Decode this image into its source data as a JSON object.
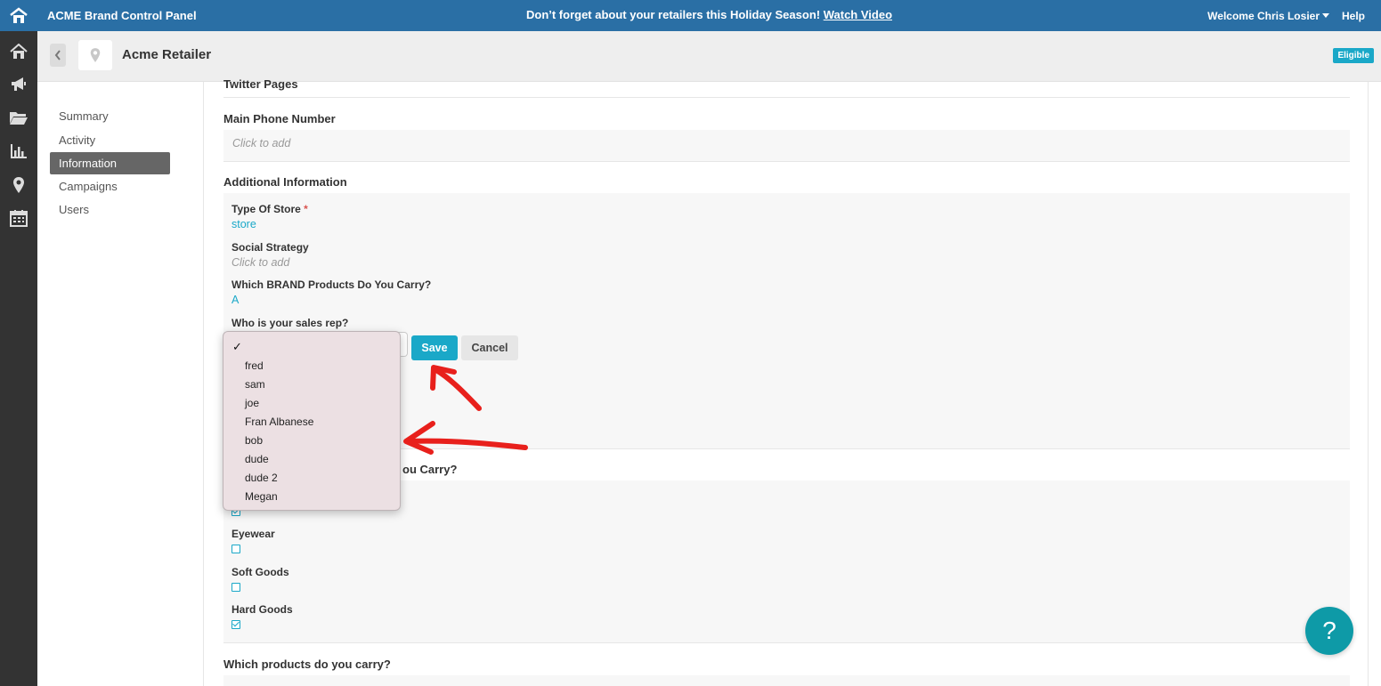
{
  "topbar": {
    "app_title": "ACME Brand Control Panel",
    "promo_text": "Don’t forget about your retailers this Holiday Season!",
    "promo_link": "Watch Video",
    "welcome": "Welcome Chris Losier",
    "help": "Help"
  },
  "rail": {
    "icons": [
      "home-icon",
      "megaphone-icon",
      "folder-icon",
      "bar-chart-icon",
      "map-pin-icon",
      "calendar-icon"
    ]
  },
  "header": {
    "retailer_name": "Acme Retailer",
    "badge": "Eligible"
  },
  "sidenav": {
    "items": [
      {
        "label": "Summary"
      },
      {
        "label": "Activity"
      },
      {
        "label": "Information"
      },
      {
        "label": "Campaigns"
      },
      {
        "label": "Users"
      }
    ]
  },
  "main": {
    "twitter_pages_title": "Twitter Pages",
    "main_phone_title": "Main Phone Number",
    "main_phone_placeholder": "Click to add",
    "additional_info_title": "Additional Information",
    "type_of_store_label": "Type Of Store",
    "required_mark": "*",
    "type_of_store_value": "store",
    "social_strategy_label": "Social Strategy",
    "social_strategy_placeholder": "Click to add",
    "brand_products_label": "Which BRAND Products Do You Carry?",
    "brand_products_value": "A",
    "sales_rep_label": "Who is your sales rep?",
    "save_label": "Save",
    "cancel_label": "Cancel",
    "partial_section_title": "ou Carry?",
    "checkbox_items": [
      {
        "label": "Eyewear",
        "checked": false
      },
      {
        "label": "Soft Goods",
        "checked": false
      },
      {
        "label": "Hard Goods",
        "checked": true
      }
    ],
    "which_products_title": "Which products do you carry?"
  },
  "dropdown": {
    "check_mark": "✓",
    "options": [
      "fred",
      "sam",
      "joe",
      "Fran Albanese",
      "bob",
      "dude",
      "dude 2",
      "Megan"
    ]
  },
  "help_bubble": "?",
  "colors": {
    "topbar": "#2a6fa5",
    "accent": "#1aa8c8",
    "rail": "#333333",
    "annotation": "#e8201c"
  }
}
